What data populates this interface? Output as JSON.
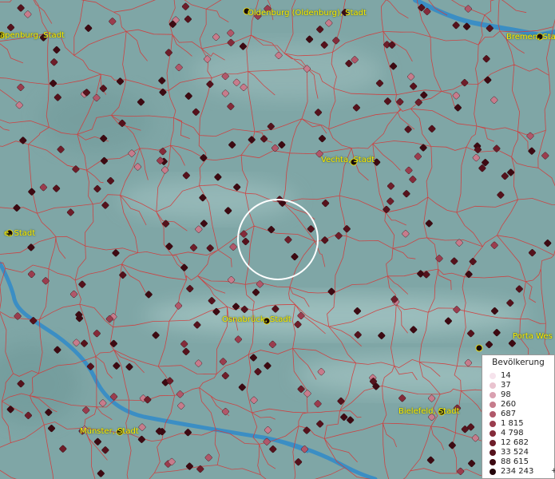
{
  "map": {
    "cities": [
      {
        "name": "Oldenburg (Oldenburg), Stadt"
      },
      {
        "name": "apenburg, Stadt"
      },
      {
        "name": "Bremen, Sta"
      },
      {
        "name": "Vechta, Stadt"
      },
      {
        "name": "e, Stadt"
      },
      {
        "name": "Osnabrück, Stadt"
      },
      {
        "name": "Porta Wes"
      },
      {
        "name": "Bielefeld, Stadt"
      },
      {
        "name": "Münster, Stadt"
      }
    ],
    "colors": {
      "land": "#7fa6a6",
      "borders": "#d33a3a",
      "rivers": "#3b8ec4",
      "labels": "#ffee00",
      "focus_circle": "#ffffff"
    }
  },
  "legend": {
    "title": "Bevölkerung",
    "items": [
      {
        "label": "14",
        "color": "#f6e3ec"
      },
      {
        "label": "37",
        "color": "#e9c3cf"
      },
      {
        "label": "98",
        "color": "#d9a0b0"
      },
      {
        "label": "260",
        "color": "#c67c8c"
      },
      {
        "label": "687",
        "color": "#b0586a"
      },
      {
        "label": "1 815",
        "color": "#9a3d4e"
      },
      {
        "label": "4 798",
        "color": "#842b3a"
      },
      {
        "label": "12 682",
        "color": "#6e1e2a"
      },
      {
        "label": "33 524",
        "color": "#55121c"
      },
      {
        "label": "88 615",
        "color": "#3d0a12"
      },
      {
        "label": "234 243",
        "color": "#24050a"
      }
    ],
    "overflow_marker": "+"
  }
}
